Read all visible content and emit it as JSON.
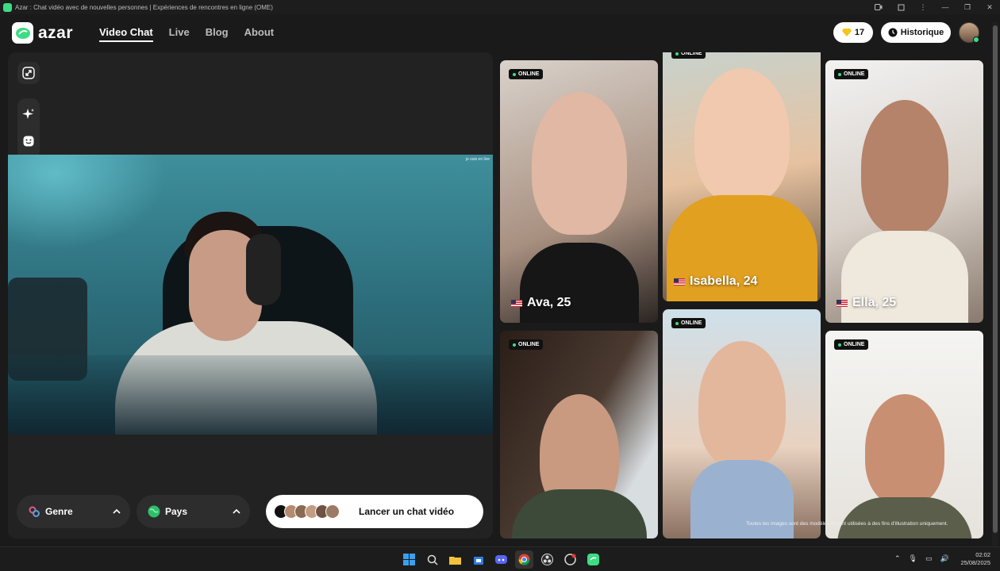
{
  "window": {
    "title": "Azar : Chat vidéo avec de nouvelles personnes | Expériences de rencontres en ligne (OME)"
  },
  "header": {
    "logo_text": "azar",
    "nav": [
      {
        "label": "Video Chat",
        "active": true
      },
      {
        "label": "Live",
        "active": false
      },
      {
        "label": "Blog",
        "active": false
      },
      {
        "label": "About",
        "active": false
      }
    ],
    "gems_count": "17",
    "history_label": "Historique"
  },
  "left_panel": {
    "camera_tag": "je suis en live",
    "genre_label": "Genre",
    "country_label": "Pays",
    "start_label": "Lancer un chat vidéo"
  },
  "gallery": {
    "status_label": "ONLINE",
    "cards": [
      {
        "name": "Ava, 25",
        "flag": "US"
      },
      {
        "name": "Isabella, 24",
        "flag": "US"
      },
      {
        "name": "Ella, 25",
        "flag": "US"
      },
      {
        "name": "",
        "flag": ""
      },
      {
        "name": "",
        "flag": ""
      },
      {
        "name": "",
        "flag": ""
      }
    ],
    "disclaimer": "Toutes les images sont des modèles et sont utilisées à des fins d'illustration uniquement."
  },
  "taskbar": {
    "time": "02:02",
    "date": "25/08/2025"
  },
  "colors": {
    "accent_green": "#3ddc84",
    "panel_bg": "#222222",
    "page_bg": "#1a1a1a"
  }
}
